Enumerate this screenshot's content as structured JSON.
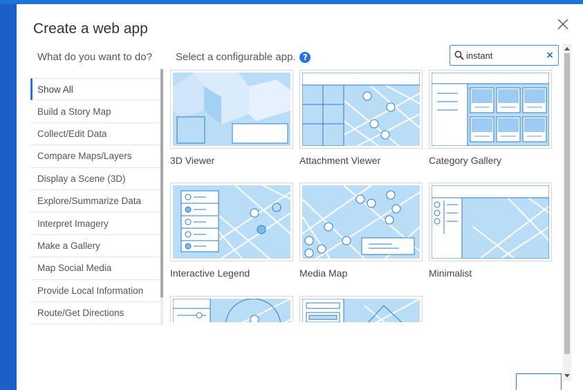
{
  "dialog": {
    "title": "Create a web app",
    "left_heading": "What do you want to do?",
    "mid_heading": "Select a configurable app.",
    "help_icon": "question-circle-icon",
    "close_icon": "close-icon"
  },
  "search": {
    "value": "instant",
    "icon": "search-icon",
    "clear_label": "×"
  },
  "categories": [
    {
      "label": "Show All",
      "active": true
    },
    {
      "label": "Build a Story Map"
    },
    {
      "label": "Collect/Edit Data"
    },
    {
      "label": "Compare Maps/Layers"
    },
    {
      "label": "Display a Scene (3D)"
    },
    {
      "label": "Explore/Summarize Data"
    },
    {
      "label": "Interpret Imagery"
    },
    {
      "label": "Make a Gallery"
    },
    {
      "label": "Map Social Media"
    },
    {
      "label": "Provide Local Information"
    },
    {
      "label": "Route/Get Directions"
    }
  ],
  "apps": [
    {
      "label": "3D Viewer"
    },
    {
      "label": "Attachment Viewer"
    },
    {
      "label": "Category Gallery"
    },
    {
      "label": "Interactive Legend"
    },
    {
      "label": "Media Map"
    },
    {
      "label": "Minimalist"
    }
  ],
  "colors": {
    "accent": "#2475d9",
    "thumb_fill": "#b9dcf7",
    "thumb_line": "#ffffff"
  }
}
